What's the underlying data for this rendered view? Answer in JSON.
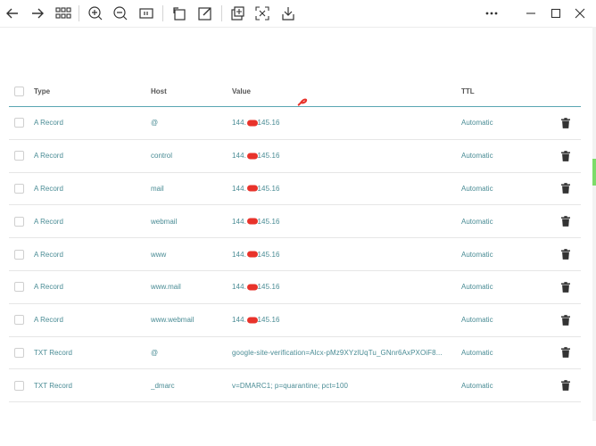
{
  "toolbar": {
    "icons": [
      "back-icon",
      "forward-icon",
      "grid-icon",
      "zoom-in-icon",
      "zoom-out-icon",
      "fit-page-icon",
      "rotate-icon",
      "edit-icon",
      "add-icon",
      "fullscreen-icon",
      "download-icon"
    ],
    "window": [
      "more-icon",
      "minimize-icon",
      "maximize-icon",
      "close-icon"
    ]
  },
  "table": {
    "headers": {
      "type": "Type",
      "host": "Host",
      "value": "Value",
      "ttl": "TTL"
    },
    "rows": [
      {
        "type": "A Record",
        "host": "@",
        "value": "144.      .145.16",
        "ttl": "Automatic"
      },
      {
        "type": "A Record",
        "host": "control",
        "value": "144.      .145.16",
        "ttl": "Automatic"
      },
      {
        "type": "A Record",
        "host": "mail",
        "value": "144.      .145.16",
        "ttl": "Automatic"
      },
      {
        "type": "A Record",
        "host": "webmail",
        "value": "144.      .145.16",
        "ttl": "Automatic"
      },
      {
        "type": "A Record",
        "host": "www",
        "value": "144.      .145.16",
        "ttl": "Automatic"
      },
      {
        "type": "A Record",
        "host": "www.mail",
        "value": "144.      .145.16",
        "ttl": "Automatic"
      },
      {
        "type": "A Record",
        "host": "www.webmail",
        "value": "144.      .145.16",
        "ttl": "Automatic"
      },
      {
        "type": "TXT Record",
        "host": "@",
        "value": "google-site-verification=Alcx-pMz9XYzlUqTu_GNnr6AxPXOiF8...",
        "ttl": "Automatic"
      },
      {
        "type": "TXT Record",
        "host": "_dmarc",
        "value": "v=DMARC1; p=quarantine; pct=100",
        "ttl": "Automatic"
      }
    ]
  },
  "colors": {
    "accent": "#4a8c95",
    "header_line": "#5aa6b2",
    "redaction": "#e8332b"
  }
}
